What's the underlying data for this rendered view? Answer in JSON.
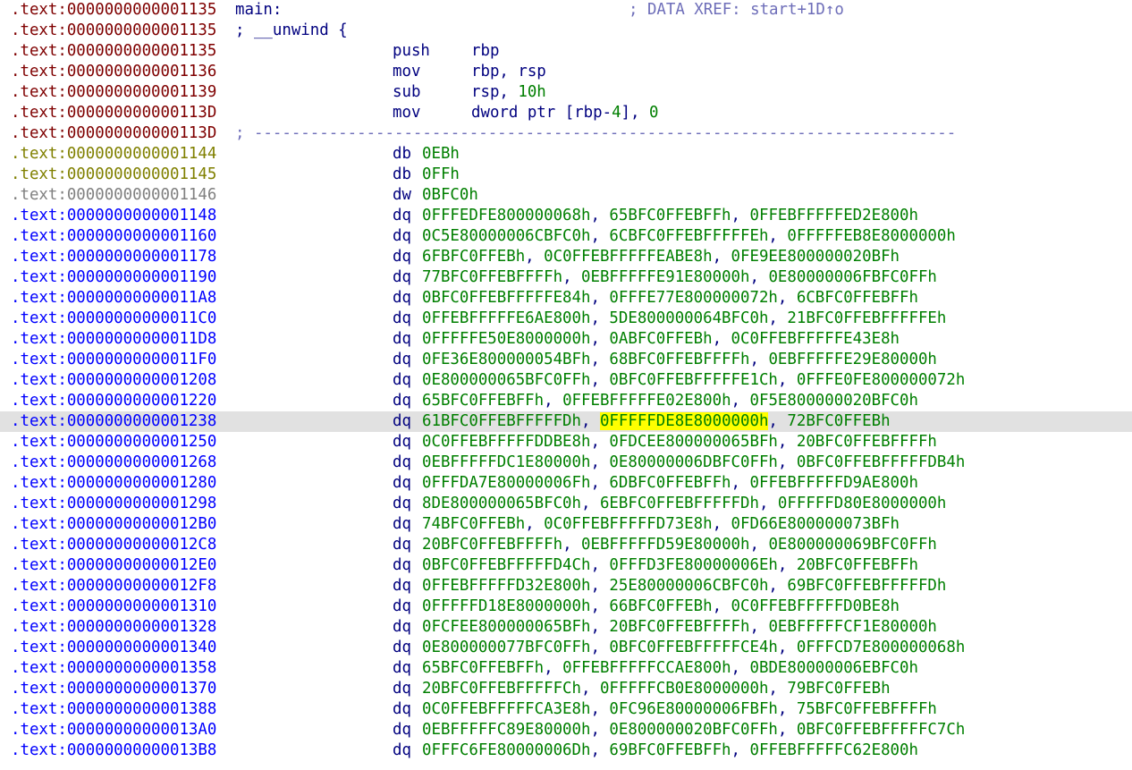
{
  "colors": {
    "addr_code": "#7f0000",
    "addr_undef": "#808000",
    "addr_unexplored": "#808080",
    "addr_data": "#0000ff",
    "mnemonic": "#00007f",
    "number": "#007f00",
    "comment": "#6e6eb9",
    "current_line_bg": "#e1e1e1",
    "highlight": "#ffff00"
  },
  "lines": [
    {
      "addr": ".text:0000000000001135",
      "kind": "code",
      "label": "main:",
      "xref": "; DATA XREF: start+1D↑o"
    },
    {
      "addr": ".text:0000000000001135",
      "kind": "code",
      "label": "; __unwind {"
    },
    {
      "addr": ".text:0000000000001135",
      "kind": "code",
      "op": "push",
      "args": [
        {
          "t": "rbp"
        }
      ]
    },
    {
      "addr": ".text:0000000000001136",
      "kind": "code",
      "op": "mov",
      "args": [
        {
          "t": "rbp, rsp"
        }
      ]
    },
    {
      "addr": ".text:0000000000001139",
      "kind": "code",
      "op": "sub",
      "args": [
        {
          "t": "rsp, "
        },
        {
          "t": "10h",
          "c": "num"
        }
      ]
    },
    {
      "addr": ".text:000000000000113D",
      "kind": "code",
      "op": "mov",
      "args": [
        {
          "t": "dword ptr [rbp-"
        },
        {
          "t": "4",
          "c": "num"
        },
        {
          "t": "], "
        },
        {
          "t": "0",
          "c": "num"
        }
      ]
    },
    {
      "addr": ".text:000000000000113D",
      "kind": "code",
      "separator": "; ---------------------------------------------------------------------------"
    },
    {
      "addr": ".text:0000000000001144",
      "kind": "undef",
      "op": "db",
      "args": [
        {
          "t": "0EBh",
          "c": "num"
        }
      ]
    },
    {
      "addr": ".text:0000000000001145",
      "kind": "undef",
      "op": "db",
      "args": [
        {
          "t": "0FFh",
          "c": "num"
        }
      ]
    },
    {
      "addr": ".text:0000000000001146",
      "kind": "unexplored",
      "op": "dw",
      "args": [
        {
          "t": "0BFC0h",
          "c": "num"
        }
      ]
    },
    {
      "addr": ".text:0000000000001148",
      "kind": "data",
      "op": "dq",
      "values": [
        "0FFFEDFE800000068h",
        "65BFC0FFEBFFh",
        "0FFEBFFFFFED2E800h"
      ]
    },
    {
      "addr": ".text:0000000000001160",
      "kind": "data",
      "op": "dq",
      "values": [
        "0C5E80000006CBFC0h",
        "6CBFC0FFEBFFFFFEh",
        "0FFFFFEB8E8000000h"
      ]
    },
    {
      "addr": ".text:0000000000001178",
      "kind": "data",
      "op": "dq",
      "values": [
        "6FBFC0FFEBh",
        "0C0FFEBFFFFFEABE8h",
        "0FE9EE800000020BFh"
      ]
    },
    {
      "addr": ".text:0000000000001190",
      "kind": "data",
      "op": "dq",
      "values": [
        "77BFC0FFEBFFFFh",
        "0EBFFFFFE91E80000h",
        "0E80000006FBFC0FFh"
      ]
    },
    {
      "addr": ".text:00000000000011A8",
      "kind": "data",
      "op": "dq",
      "values": [
        "0BFC0FFEBFFFFFE84h",
        "0FFFE77E800000072h",
        "6CBFC0FFEBFFh"
      ]
    },
    {
      "addr": ".text:00000000000011C0",
      "kind": "data",
      "op": "dq",
      "values": [
        "0FFEBFFFFFE6AE800h",
        "5DE800000064BFC0h",
        "21BFC0FFEBFFFFFEh"
      ]
    },
    {
      "addr": ".text:00000000000011D8",
      "kind": "data",
      "op": "dq",
      "values": [
        "0FFFFFE50E8000000h",
        "0ABFC0FFEBh",
        "0C0FFEBFFFFFE43E8h"
      ]
    },
    {
      "addr": ".text:00000000000011F0",
      "kind": "data",
      "op": "dq",
      "values": [
        "0FE36E800000054BFh",
        "68BFC0FFEBFFFFh",
        "0EBFFFFFE29E80000h"
      ]
    },
    {
      "addr": ".text:0000000000001208",
      "kind": "data",
      "op": "dq",
      "values": [
        "0E800000065BFC0FFh",
        "0BFC0FFEBFFFFFE1Ch",
        "0FFFE0FE800000072h"
      ]
    },
    {
      "addr": ".text:0000000000001220",
      "kind": "data",
      "op": "dq",
      "values": [
        "65BFC0FFEBFFh",
        "0FFEBFFFFFE02E800h",
        "0F5E800000020BFC0h"
      ]
    },
    {
      "addr": ".text:0000000000001238",
      "kind": "data",
      "op": "dq",
      "current": true,
      "highlight": 1,
      "values": [
        "61BFC0FFEBFFFFFDh",
        "0FFFFFDE8E8000000h",
        "72BFC0FFEBh"
      ]
    },
    {
      "addr": ".text:0000000000001250",
      "kind": "data",
      "op": "dq",
      "values": [
        "0C0FFEBFFFFFDDBE8h",
        "0FDCEE800000065BFh",
        "20BFC0FFEBFFFFh"
      ]
    },
    {
      "addr": ".text:0000000000001268",
      "kind": "data",
      "op": "dq",
      "values": [
        "0EBFFFFFDC1E80000h",
        "0E80000006DBFC0FFh",
        "0BFC0FFEBFFFFFDB4h"
      ]
    },
    {
      "addr": ".text:0000000000001280",
      "kind": "data",
      "op": "dq",
      "values": [
        "0FFFDA7E80000006Fh",
        "6DBFC0FFEBFFh",
        "0FFEBFFFFFD9AE800h"
      ]
    },
    {
      "addr": ".text:0000000000001298",
      "kind": "data",
      "op": "dq",
      "values": [
        "8DE800000065BFC0h",
        "6EBFC0FFEBFFFFFDh",
        "0FFFFFD80E8000000h"
      ]
    },
    {
      "addr": ".text:00000000000012B0",
      "kind": "data",
      "op": "dq",
      "values": [
        "74BFC0FFEBh",
        "0C0FFEBFFFFFD73E8h",
        "0FD66E800000073BFh"
      ]
    },
    {
      "addr": ".text:00000000000012C8",
      "kind": "data",
      "op": "dq",
      "values": [
        "20BFC0FFEBFFFFh",
        "0EBFFFFFD59E80000h",
        "0E800000069BFC0FFh"
      ]
    },
    {
      "addr": ".text:00000000000012E0",
      "kind": "data",
      "op": "dq",
      "values": [
        "0BFC0FFEBFFFFFD4Ch",
        "0FFFD3FE80000006Eh",
        "20BFC0FFEBFFh"
      ]
    },
    {
      "addr": ".text:00000000000012F8",
      "kind": "data",
      "op": "dq",
      "values": [
        "0FFEBFFFFFD32E800h",
        "25E80000006CBFC0h",
        "69BFC0FFEBFFFFFDh"
      ]
    },
    {
      "addr": ".text:0000000000001310",
      "kind": "data",
      "op": "dq",
      "values": [
        "0FFFFFD18E8000000h",
        "66BFC0FFEBh",
        "0C0FFEBFFFFFD0BE8h"
      ]
    },
    {
      "addr": ".text:0000000000001328",
      "kind": "data",
      "op": "dq",
      "values": [
        "0FCFEE800000065BFh",
        "20BFC0FFEBFFFFh",
        "0EBFFFFFCF1E80000h"
      ]
    },
    {
      "addr": ".text:0000000000001340",
      "kind": "data",
      "op": "dq",
      "values": [
        "0E800000077BFC0FFh",
        "0BFC0FFEBFFFFFCE4h",
        "0FFFCD7E800000068h"
      ]
    },
    {
      "addr": ".text:0000000000001358",
      "kind": "data",
      "op": "dq",
      "values": [
        "65BFC0FFEBFFh",
        "0FFEBFFFFFCCAE800h",
        "0BDE80000006EBFC0h"
      ]
    },
    {
      "addr": ".text:0000000000001370",
      "kind": "data",
      "op": "dq",
      "values": [
        "20BFC0FFEBFFFFFCh",
        "0FFFFFCB0E8000000h",
        "79BFC0FFEBh"
      ]
    },
    {
      "addr": ".text:0000000000001388",
      "kind": "data",
      "op": "dq",
      "values": [
        "0C0FFEBFFFFFCA3E8h",
        "0FC96E80000006FBFh",
        "75BFC0FFEBFFFFh"
      ]
    },
    {
      "addr": ".text:00000000000013A0",
      "kind": "data",
      "op": "dq",
      "values": [
        "0EBFFFFFC89E80000h",
        "0E800000020BFC0FFh",
        "0BFC0FFEBFFFFFC7Ch"
      ]
    },
    {
      "addr": ".text:00000000000013B8",
      "kind": "data",
      "op": "dq",
      "values": [
        "0FFFC6FE80000006Dh",
        "69BFC0FFEBFFh",
        "0FFEBFFFFFC62E800h"
      ]
    }
  ]
}
